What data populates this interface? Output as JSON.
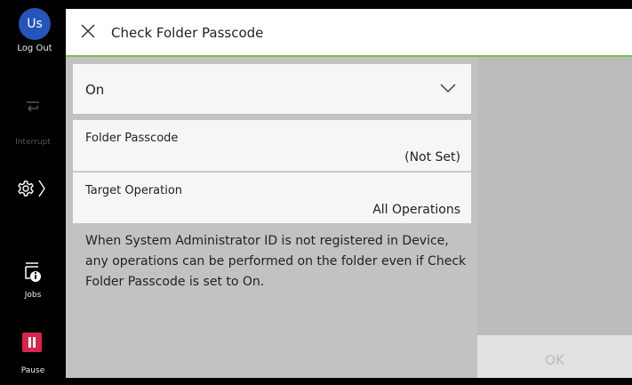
{
  "rail": {
    "avatar_initials": "Us",
    "logout_label": "Log Out",
    "interrupt_label": "Interrupt",
    "jobs_label": "Jobs",
    "pause_label": "Pause",
    "avatar_color": "#2455b8",
    "pause_color": "#d9234c"
  },
  "header": {
    "title": "Check Folder Passcode",
    "accent": "#7cc04a"
  },
  "form": {
    "mode_value": "On",
    "folder_passcode_label": "Folder Passcode",
    "folder_passcode_value": "(Not Set)",
    "target_operation_label": "Target Operation",
    "target_operation_value": "All Operations",
    "note": "When System Administrator ID is not registered in Device, any operations can be performed on the folder even if Check Folder Passcode is set to On."
  },
  "footer": {
    "ok_label": "OK"
  },
  "icons": [
    "close-icon",
    "chevron-down-icon",
    "interrupt-icon",
    "gear-icon",
    "chevron-right-icon",
    "jobs-icon",
    "pause-icon"
  ]
}
